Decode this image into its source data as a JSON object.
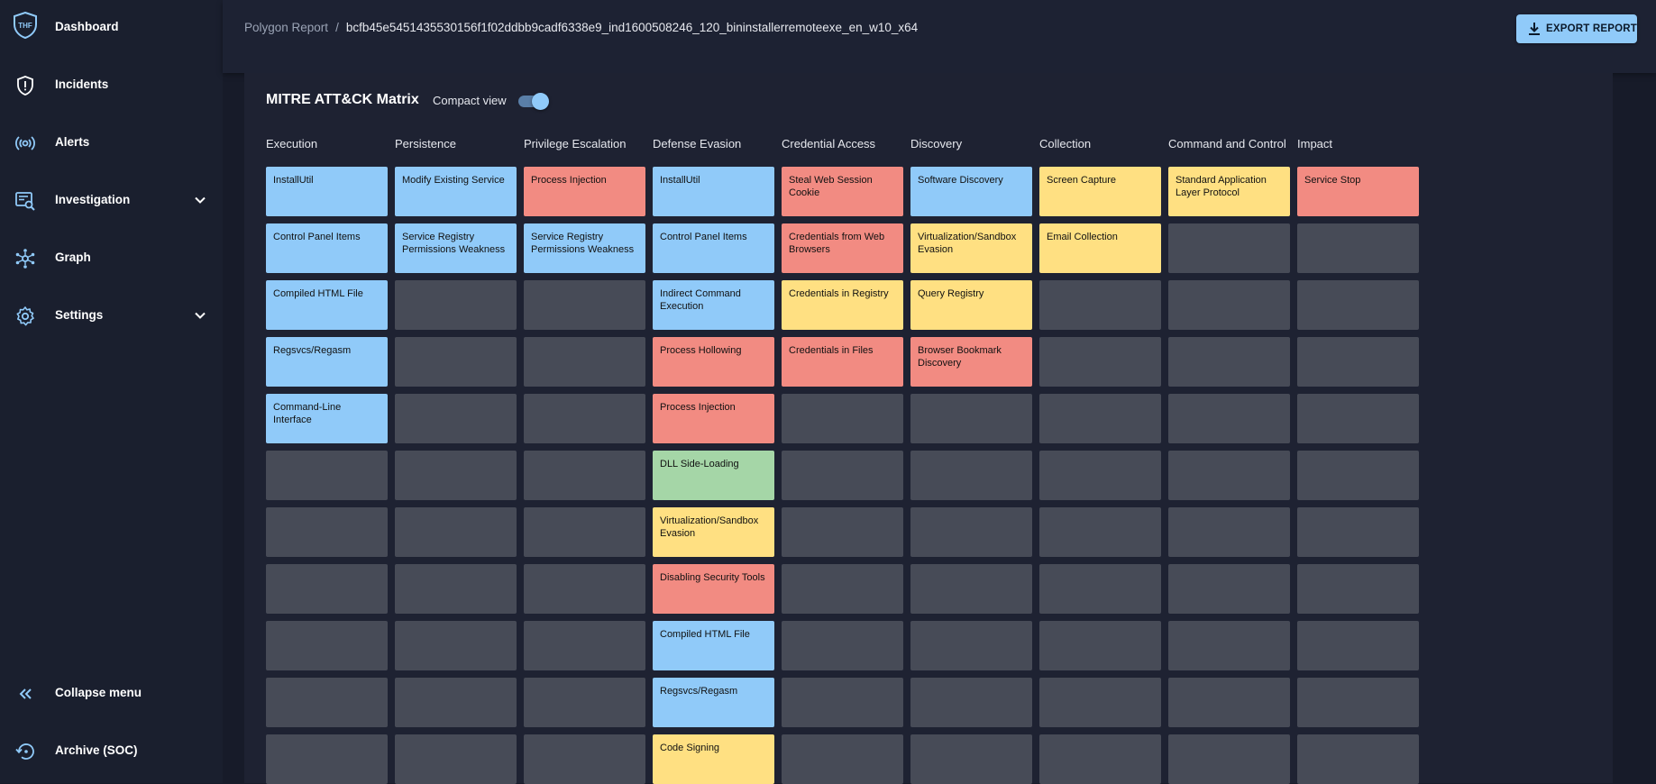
{
  "sidebar": {
    "logo_text": "THF",
    "items": [
      {
        "label": "Dashboard",
        "icon": "shield-logo-icon"
      },
      {
        "label": "Incidents",
        "icon": "shield-alert-icon"
      },
      {
        "label": "Alerts",
        "icon": "broadcast-icon"
      },
      {
        "label": "Investigation",
        "icon": "investigation-icon"
      },
      {
        "label": "Graph",
        "icon": "graph-icon"
      },
      {
        "label": "Settings",
        "icon": "gear-icon"
      }
    ],
    "collapse_label": "Collapse menu",
    "archive_label": "Archive (SOC)"
  },
  "header": {
    "breadcrumb_root": "Polygon Report",
    "breadcrumb_sep": "/",
    "breadcrumb_current": "bcfb45e5451435530156f1f02ddbb9cadf6338e9_ind1600508246_120_bininstallerremoteexe_en_w10_x64",
    "export_label": "EXPORT REPORT"
  },
  "matrix": {
    "title": "MITRE ATT&CK Matrix",
    "compact_view_label": "Compact view",
    "compact_view_on": true,
    "colors": {
      "blue": "#90caf9",
      "red": "#f28b82",
      "yellow": "#ffe082",
      "green": "#a5d6a7",
      "empty": "#474b57"
    },
    "columns": [
      {
        "name": "Execution",
        "techniques": [
          {
            "label": "InstallUtil",
            "color": "blue"
          },
          {
            "label": "Control Panel Items",
            "color": "blue"
          },
          {
            "label": "Compiled HTML File",
            "color": "blue"
          },
          {
            "label": "Regsvcs/Regasm",
            "color": "blue"
          },
          {
            "label": "Command-Line Interface",
            "color": "blue"
          }
        ]
      },
      {
        "name": "Persistence",
        "techniques": [
          {
            "label": "Modify Existing Service",
            "color": "blue"
          },
          {
            "label": "Service Registry Permissions Weakness",
            "color": "blue"
          }
        ]
      },
      {
        "name": "Privilege Escalation",
        "techniques": [
          {
            "label": "Process Injection",
            "color": "red"
          },
          {
            "label": "Service Registry Permissions Weakness",
            "color": "blue"
          }
        ]
      },
      {
        "name": "Defense Evasion",
        "techniques": [
          {
            "label": "InstallUtil",
            "color": "blue"
          },
          {
            "label": "Control Panel Items",
            "color": "blue"
          },
          {
            "label": "Indirect Command Execution",
            "color": "blue"
          },
          {
            "label": "Process Hollowing",
            "color": "red"
          },
          {
            "label": "Process Injection",
            "color": "red"
          },
          {
            "label": "DLL Side-Loading",
            "color": "green"
          },
          {
            "label": "Virtualization/Sandbox Evasion",
            "color": "yellow"
          },
          {
            "label": "Disabling Security Tools",
            "color": "red"
          },
          {
            "label": "Compiled HTML File",
            "color": "blue"
          },
          {
            "label": "Regsvcs/Regasm",
            "color": "blue"
          },
          {
            "label": "Code Signing",
            "color": "yellow"
          }
        ]
      },
      {
        "name": "Credential Access",
        "techniques": [
          {
            "label": "Steal Web Session Cookie",
            "color": "red"
          },
          {
            "label": "Credentials from Web Browsers",
            "color": "red"
          },
          {
            "label": "Credentials in Registry",
            "color": "yellow"
          },
          {
            "label": "Credentials in Files",
            "color": "red"
          }
        ]
      },
      {
        "name": "Discovery",
        "techniques": [
          {
            "label": "Software Discovery",
            "color": "blue"
          },
          {
            "label": "Virtualization/Sandbox Evasion",
            "color": "yellow"
          },
          {
            "label": "Query Registry",
            "color": "yellow"
          },
          {
            "label": "Browser Bookmark Discovery",
            "color": "red"
          }
        ]
      },
      {
        "name": "Collection",
        "techniques": [
          {
            "label": "Screen Capture",
            "color": "yellow"
          },
          {
            "label": "Email Collection",
            "color": "yellow"
          }
        ]
      },
      {
        "name": "Command and Control",
        "techniques": [
          {
            "label": "Standard Application Layer Protocol",
            "color": "yellow"
          }
        ]
      },
      {
        "name": "Impact",
        "techniques": [
          {
            "label": "Service Stop",
            "color": "red"
          }
        ]
      }
    ]
  }
}
